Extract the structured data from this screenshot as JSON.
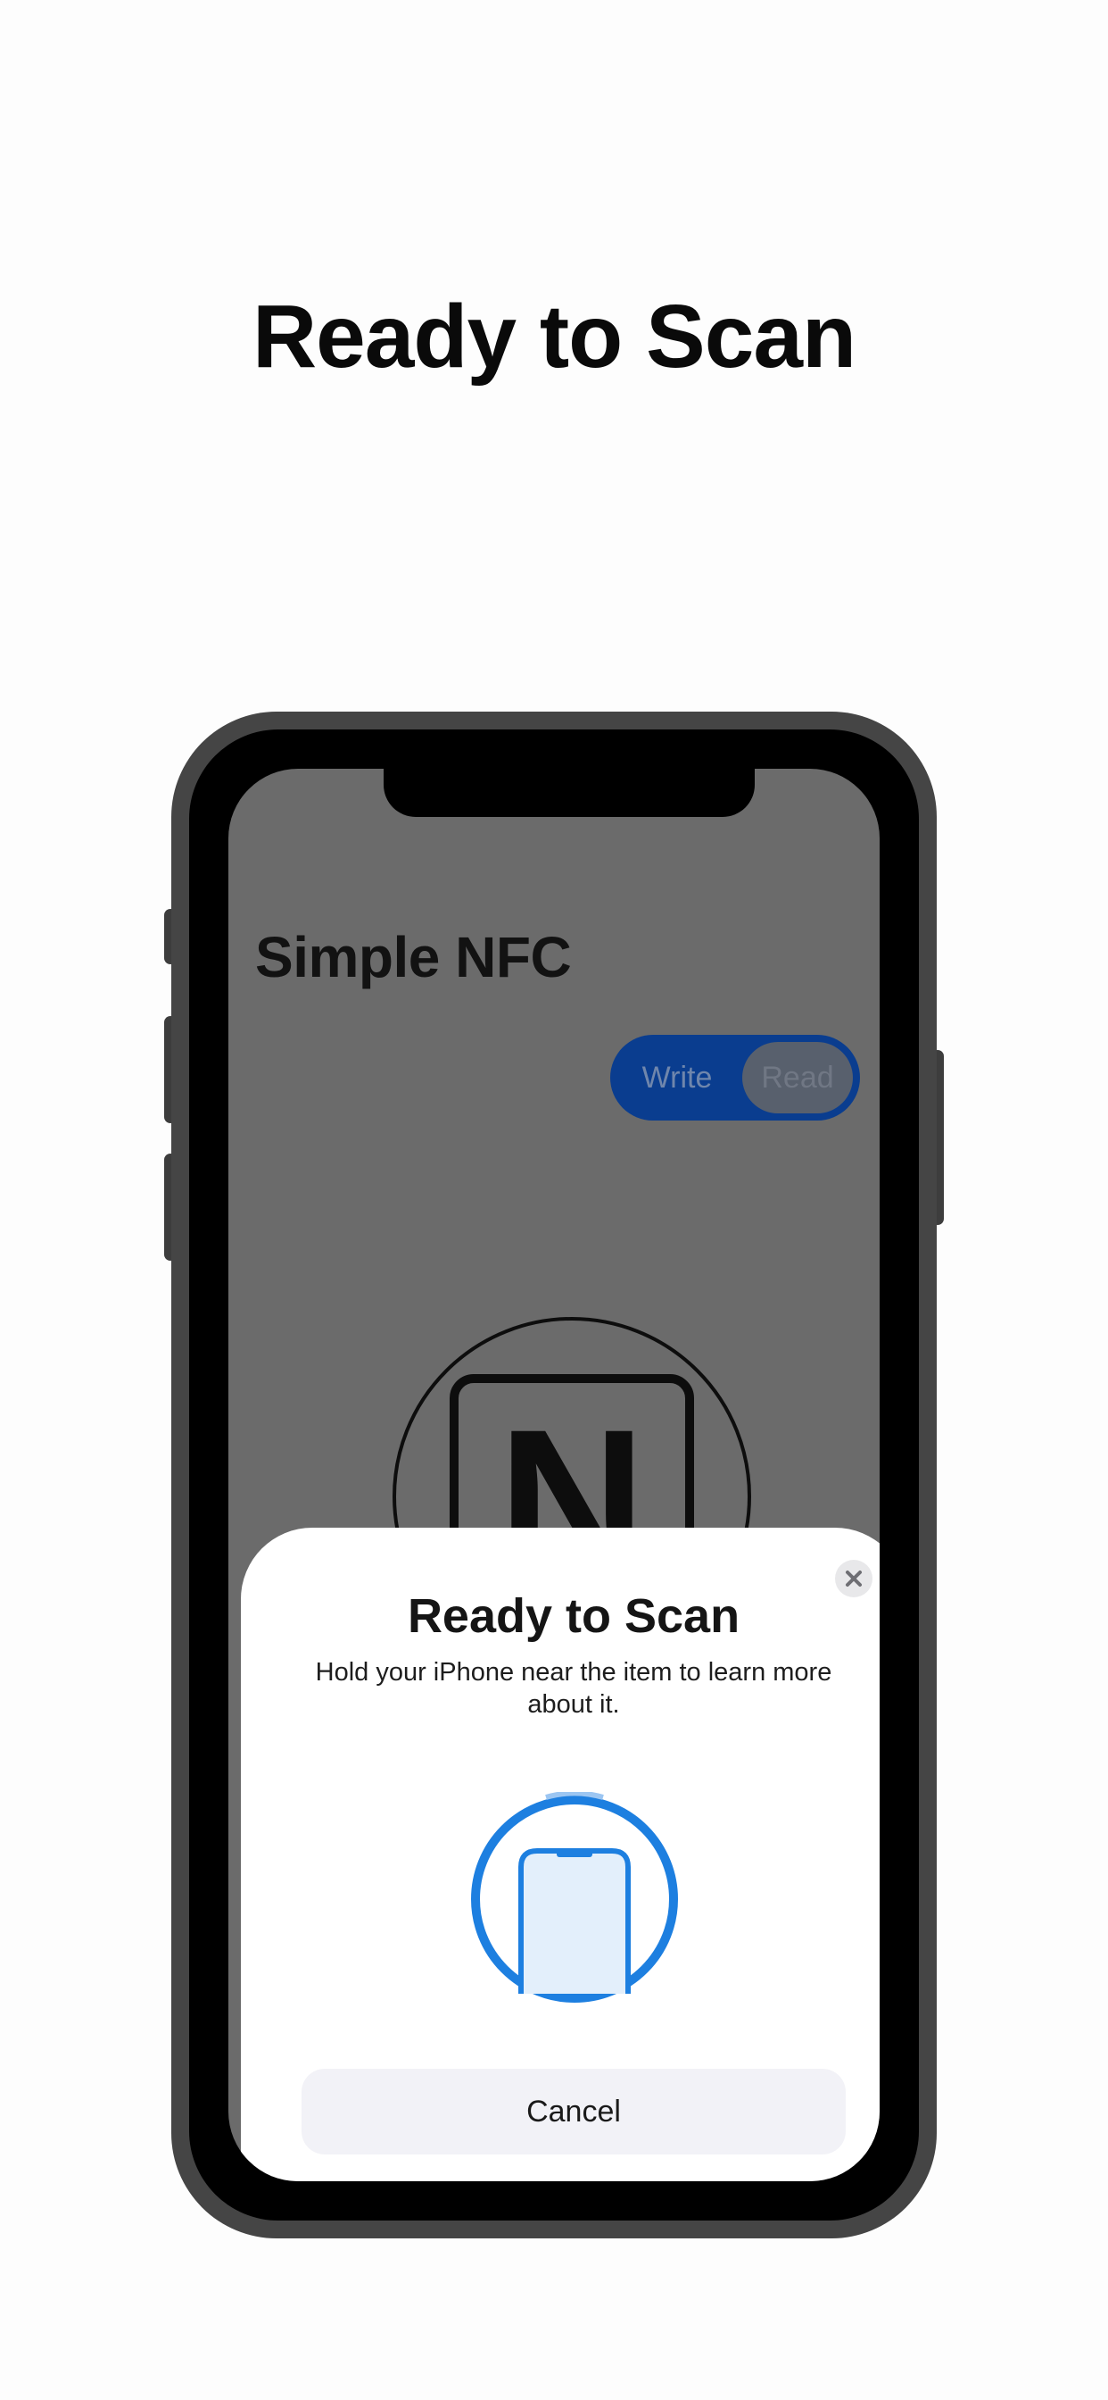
{
  "headline": "Ready to Scan",
  "app": {
    "title": "Simple NFC",
    "mode_options": [
      "Write",
      "Read"
    ],
    "selected_mode": "Read",
    "logo_letter": "N"
  },
  "scan_sheet": {
    "title": "Ready to Scan",
    "subtitle": "Hold your iPhone near the item to learn more about it.",
    "close_icon": "close-icon",
    "cancel_label": "Cancel",
    "accent_color": "#1d7fe0"
  },
  "colors": {
    "phone_frame": "#454545",
    "screen_dim": "#6b6b6b",
    "segment_bg": "#0a3d8f"
  }
}
